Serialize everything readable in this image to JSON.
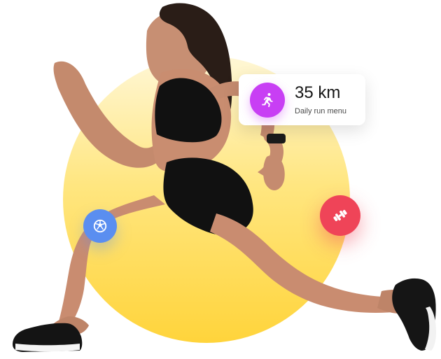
{
  "stat_card": {
    "value": "35 km",
    "label": "Daily run menu",
    "icon": "running-person-icon",
    "icon_color": "#c83ff4"
  },
  "badges": [
    {
      "icon": "soccer-ball-icon",
      "color": "#5a8ef0"
    },
    {
      "icon": "dumbbell-icon",
      "color": "#ef4458"
    }
  ],
  "colors": {
    "circle_top": "#fff7d6",
    "circle_mid": "#ffe680",
    "circle_bottom": "#ffd43b",
    "runner_outfit": "#111111"
  }
}
